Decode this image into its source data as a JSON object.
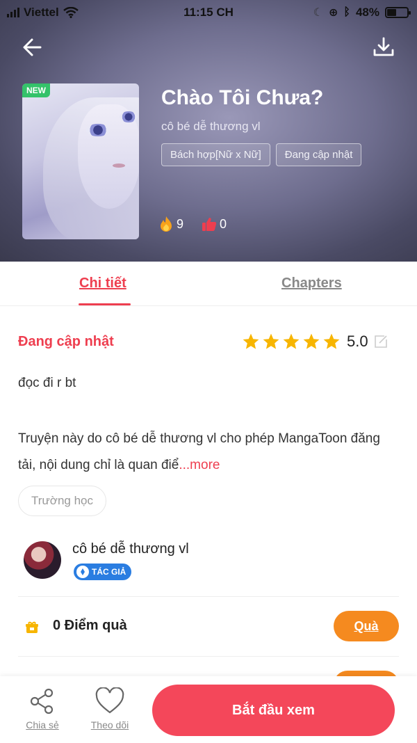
{
  "status_bar": {
    "carrier": "Viettel",
    "time": "11:15 CH",
    "battery": "48%",
    "battery_level": 0.48
  },
  "header": {
    "cover_badge": "NEW",
    "title": "Chào Tôi Chưa?",
    "author": "cô bé dễ thương vl",
    "genres": [
      "Bách hợp[Nữ x Nữ]",
      "Đang cập nhật"
    ],
    "fire_count": "9",
    "like_count": "0"
  },
  "tabs": {
    "detail": "Chi tiết",
    "chapters": "Chapters"
  },
  "detail": {
    "status": "Đang cập nhật",
    "stars": 5,
    "rating": "5.0",
    "short_desc": "đọc đi r bt",
    "long_desc": "Truyện này do cô bé dễ thương vl cho phép MangaToon đăng tải, nội dung chỉ là quan điể",
    "more_label": "...more",
    "tag": "Trường học"
  },
  "author_row": {
    "name": "cô bé dễ thương vl",
    "badge": "TÁC GIẢ"
  },
  "gift_row": {
    "label": "0 Điểm quà",
    "button": "Quà"
  },
  "bottom_bar": {
    "share": "Chia sẻ",
    "follow": "Theo dõi",
    "start": "Bắt đầu xem"
  },
  "colors": {
    "accent": "#ee3e4f",
    "start_button": "#f4475a",
    "gift_button": "#f58a1f",
    "star": "#f7b500",
    "author_badge": "#2a7de1"
  }
}
